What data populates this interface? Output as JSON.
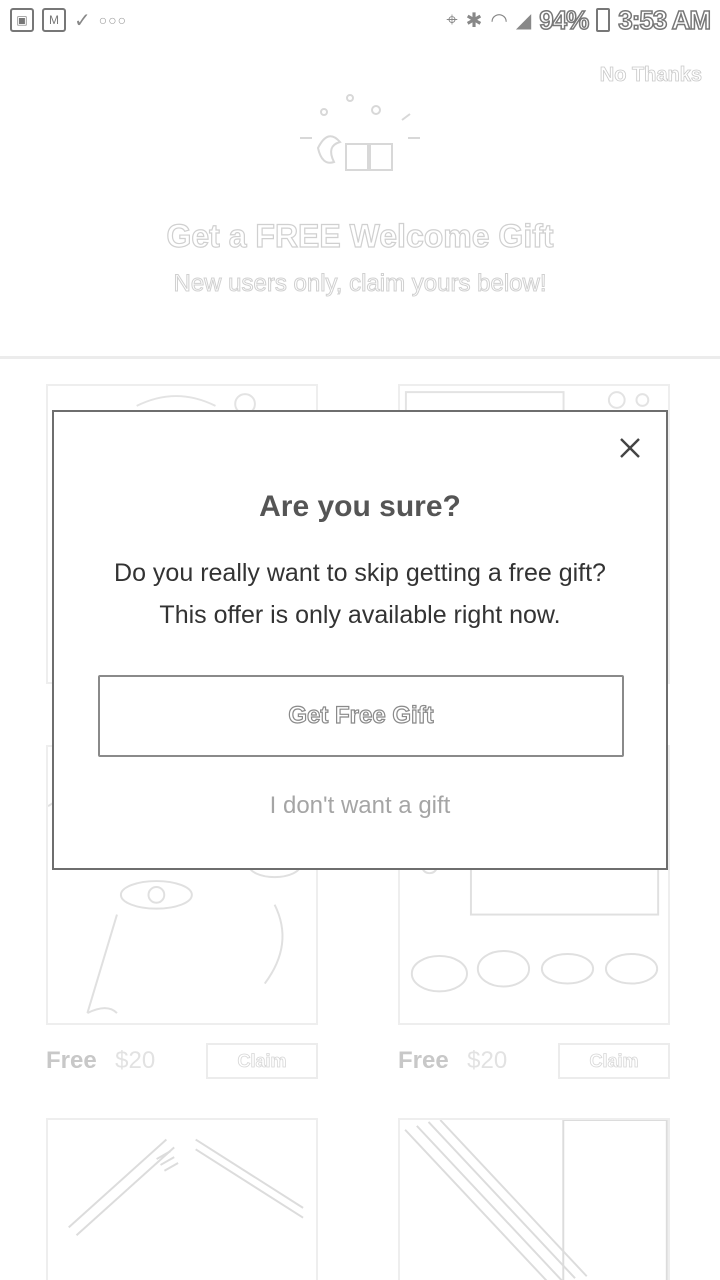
{
  "status_bar": {
    "battery": "94%",
    "time": "3:53 AM",
    "notification_icons": [
      "image-icon",
      "gmail-icon",
      "checkmark-icon",
      "more-dots-icon"
    ],
    "system_icons": [
      "location-icon",
      "bluetooth-icon",
      "wifi-icon",
      "signal-icon",
      "battery-icon"
    ]
  },
  "page": {
    "no_thanks": "No Thanks",
    "title": "Get a FREE Welcome Gift",
    "subtitle": "New users only, claim yours below!"
  },
  "products": [
    {
      "price": "Free",
      "original_price": "$20",
      "claim_label": "Claim"
    },
    {
      "price": "Free",
      "original_price": "$20",
      "claim_label": "Claim"
    }
  ],
  "modal": {
    "title": "Are you sure?",
    "body": "Do you really want to skip getting a free gift? This offer is only available right now.",
    "primary_button": "Get Free Gift",
    "secondary_link": "I don't want a gift"
  },
  "colors": {
    "modal_border": "#6e6e6e",
    "button_border": "#8a8a8a",
    "muted_text": "#a5a5a5"
  }
}
